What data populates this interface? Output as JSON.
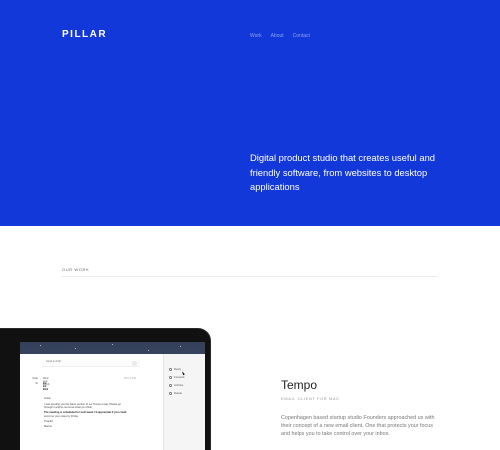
{
  "header": {
    "logo": "PILLAR",
    "nav": [
      "Work",
      "About",
      "Contact"
    ]
  },
  "hero": {
    "tagline": "Digital product studio that creates useful and friendly software, from websites to desktop applications"
  },
  "work_section": {
    "label": "OUR WORK"
  },
  "laptop_mail": {
    "from_label": "Send to draft",
    "rows": [
      {
        "key": "Date",
        "value": "Wed and sundt",
        "meta": "Wed 3 PM"
      },
      {
        "key": "To",
        "value": "Ed Ed Bird",
        "meta": ""
      }
    ],
    "greeting": "Hi Ed,",
    "paragraphs": [
      "I was sending you the latest version of our Tempo email. Please go",
      "through it and let me know what you think.",
      "The meeting is scheduled for next week. I'd appreciate if you could",
      "send me your notes by Friday."
    ],
    "signoff": "Thanks!",
    "signature": "Marius",
    "side_items": [
      "Reply",
      "Forward",
      "Archive",
      "Delete"
    ]
  },
  "project": {
    "title": "Tempo",
    "subtitle": "EMAIL CLIENT FOR MAC",
    "description": "Copenhagen based startup studio Founders approached us with their concept of a new email client. One that protects your focus and helps you to take control over your inbox."
  },
  "colors": {
    "brand_blue": "#1238d9",
    "nav_text": "#8ea3f2",
    "background": "#ffffff"
  }
}
